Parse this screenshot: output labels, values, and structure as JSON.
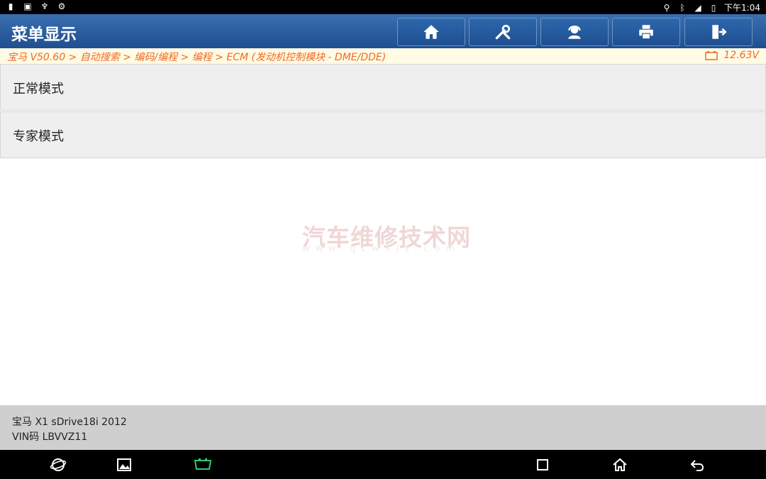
{
  "status_bar": {
    "time": "下午1:04"
  },
  "header": {
    "title": "菜单显示"
  },
  "toolbar": {
    "buttons": [
      "home-icon",
      "diagnose-icon",
      "support-icon",
      "print-icon",
      "exit-icon"
    ]
  },
  "breadcrumb": {
    "path": "宝马 V50.60 > 自动搜索 > 编码/编程 > 编程 > ECM (发动机控制模块 - DME/DDE)",
    "voltage": "12.63V"
  },
  "menu": {
    "items": [
      {
        "label": "正常模式"
      },
      {
        "label": "专家模式"
      }
    ]
  },
  "watermark": {
    "text": "汽车维修技术网",
    "url": "www.qcwxjs.com"
  },
  "footer": {
    "vehicle": "宝马 X1 sDrive18i 2012",
    "vin": "VIN码 LBVVZ11"
  },
  "colors": {
    "accent": "#1f4f8f",
    "breadcrumb": "#f06a24",
    "vci": "#2ecc71"
  }
}
